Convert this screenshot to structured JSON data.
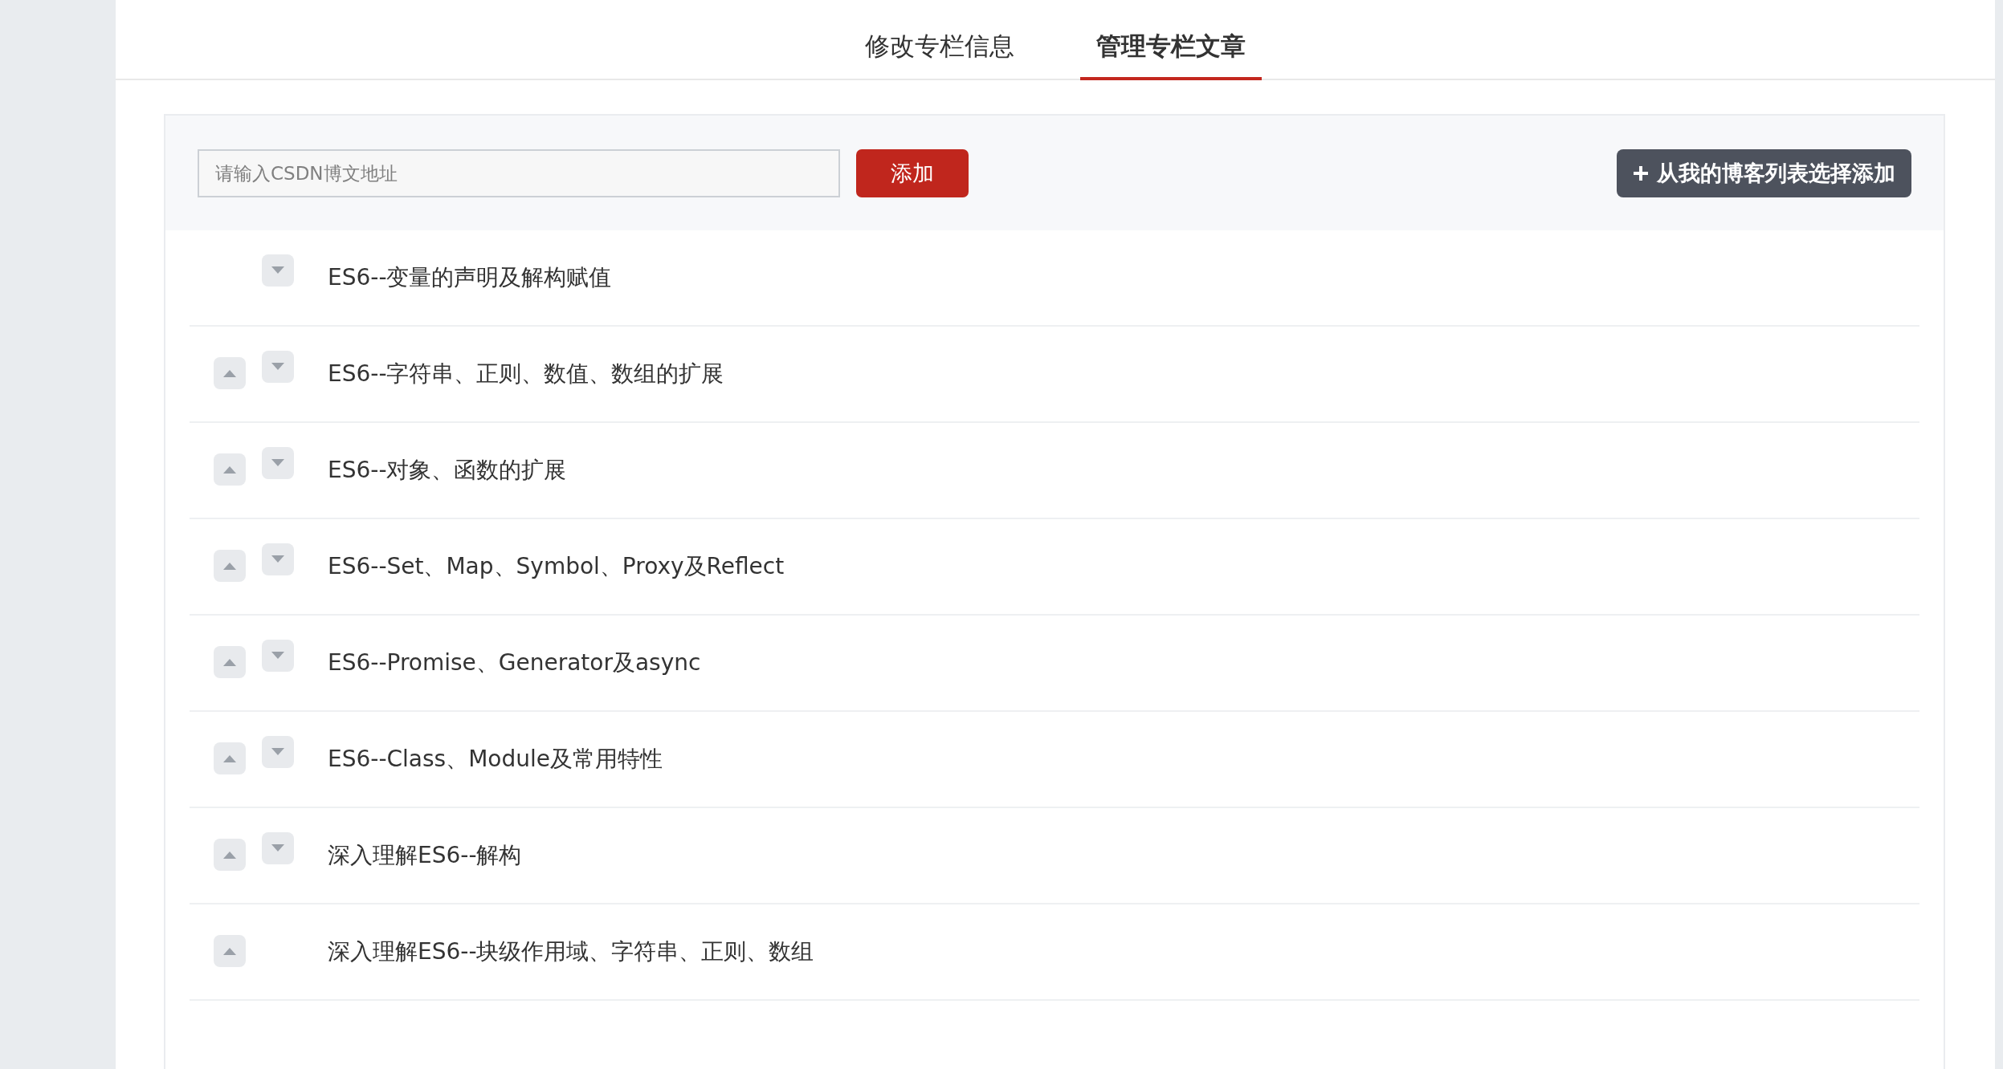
{
  "tabs": [
    {
      "label": "修改专栏信息",
      "selected": false
    },
    {
      "label": "管理专栏文章",
      "selected": true
    }
  ],
  "toolbar": {
    "url_field": {
      "placeholder": "请输入CSDN博文地址"
    },
    "add_button": "添加",
    "pick_button": "从我的博客列表选择添加"
  },
  "articles": [
    {
      "title": "ES6--变量的声明及解构赋值",
      "can_move_up": false,
      "can_move_down": true
    },
    {
      "title": "ES6--字符串、正则、数值、数组的扩展",
      "can_move_up": true,
      "can_move_down": true
    },
    {
      "title": "ES6--对象、函数的扩展",
      "can_move_up": true,
      "can_move_down": true
    },
    {
      "title": "ES6--Set、Map、Symbol、Proxy及Reflect",
      "can_move_up": true,
      "can_move_down": true
    },
    {
      "title": "ES6--Promise、Generator及async",
      "can_move_up": true,
      "can_move_down": true
    },
    {
      "title": "ES6--Class、Module及常用特性",
      "can_move_up": true,
      "can_move_down": true
    },
    {
      "title": "深入理解ES6--解构",
      "can_move_up": true,
      "can_move_down": true
    },
    {
      "title": "深入理解ES6--块级作用域、字符串、正则、数组",
      "can_move_up": true,
      "can_move_down": false
    }
  ]
}
